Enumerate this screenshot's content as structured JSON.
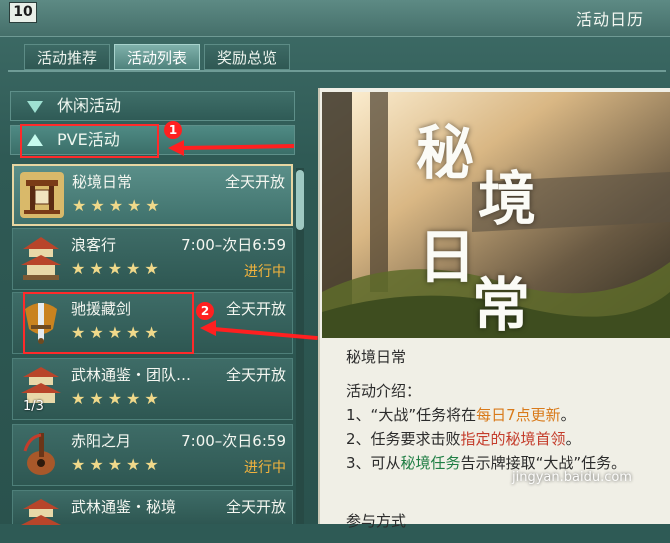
{
  "window": {
    "level": "10",
    "title": "活动日历"
  },
  "tabs": [
    {
      "label": "活动推荐",
      "active": false
    },
    {
      "label": "活动列表",
      "active": true
    },
    {
      "label": "奖励总览",
      "active": false
    }
  ],
  "categories": {
    "leisure": "休闲活动",
    "pve": "PVE活动"
  },
  "annotations": {
    "badge1": "1",
    "badge2": "2"
  },
  "activities": [
    {
      "name": "秘境日常",
      "time": "全天开放",
      "status": "",
      "stars": "★★★★★",
      "count": "",
      "selected": true
    },
    {
      "name": "浪客行",
      "time": "7:00–次日6:59",
      "status": "进行中",
      "stars": "★★★★★",
      "count": "",
      "selected": false
    },
    {
      "name": "驰援藏剑",
      "time": "全天开放",
      "status": "",
      "stars": "★★★★★",
      "count": "",
      "selected": false
    },
    {
      "name": "武林通鉴・团队…",
      "time": "全天开放",
      "status": "",
      "stars": "★★★★★",
      "count": "1/3",
      "selected": false
    },
    {
      "name": "赤阳之月",
      "time": "7:00–次日6:59",
      "status": "进行中",
      "stars": "★★★★★",
      "count": "",
      "selected": false
    },
    {
      "name": "武林通鉴・秘境",
      "time": "全天开放",
      "status": "",
      "stars": "",
      "count": "",
      "selected": false
    }
  ],
  "detail": {
    "banner_title": [
      "秘",
      "境",
      "日",
      "常"
    ],
    "title": "秘境日常",
    "intro_heading": "活动介绍：",
    "line1": {
      "pre": "1、“大战”任务将在",
      "hl": "每日7点更新",
      "post": "。"
    },
    "line2": {
      "pre": "2、任务要求击败",
      "hl": "指定的秘境首领",
      "post": "。"
    },
    "line3": {
      "pre": "3、可从",
      "hl": "秘境任务",
      "post": "告示牌接取“大战”任务。"
    },
    "next_heading": "参与方式"
  },
  "watermark": "jingyan.baidu.com",
  "colors": {
    "accent_red": "#ff2020",
    "highlight_orange": "#d97a1a",
    "highlight_red": "#c43c2b",
    "highlight_green": "#1f7e44"
  }
}
